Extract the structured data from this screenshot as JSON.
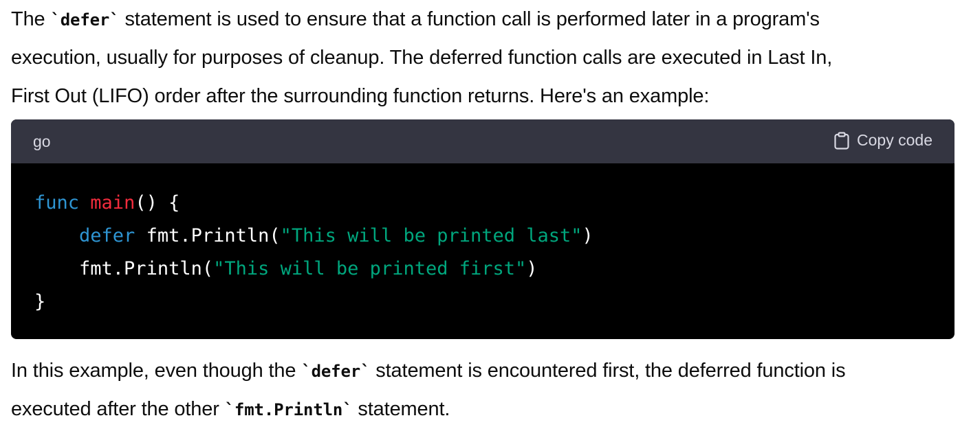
{
  "intro": {
    "line1_before": "The ",
    "line1_code": "`defer`",
    "line1_after": " statement is used to ensure that a function call is performed later in a program's",
    "line2": "execution, usually for purposes of cleanup. The deferred function calls are executed in Last In,",
    "line3": "First Out (LIFO) order after the surrounding function returns. Here's an example:"
  },
  "code_block": {
    "language": "go",
    "copy_label": "Copy code",
    "lines": [
      {
        "kw": "func",
        "sp1": " ",
        "fn": "main",
        "rest": "() {"
      },
      {
        "indent": "    ",
        "kw": "defer",
        "call": " fmt.Println(",
        "str": "\"This will be printed last\"",
        "close": ")"
      },
      {
        "indent": "    ",
        "call": "fmt.Println(",
        "str": "\"This will be printed first\"",
        "close": ")"
      },
      {
        "text": "}"
      }
    ]
  },
  "outro": {
    "line1_before": "In this example, even though the ",
    "line1_code": "`defer`",
    "line1_after": " statement is encountered first, the deferred function is",
    "line2_before": "executed after the other ",
    "line2_code": "`fmt.Println`",
    "line2_after": " statement."
  },
  "colors": {
    "keyword": "#2e95d3",
    "function_name": "#f22c3d",
    "string": "#00a67d",
    "code_header_bg": "#343541",
    "code_bg": "#000000"
  },
  "icons": {
    "copy": "clipboard-icon"
  }
}
